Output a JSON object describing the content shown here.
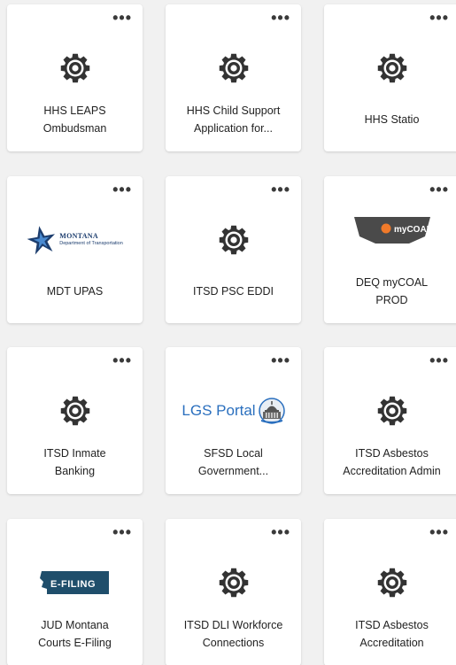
{
  "tiles": [
    {
      "label_line1": "HHS LEAPS",
      "label_line2": "Ombudsman",
      "icon": "gear-icon",
      "more": "•••"
    },
    {
      "label_line1": "HHS Child Support",
      "label_line2": "Application for...",
      "icon": "gear-icon",
      "more": "•••"
    },
    {
      "label_line1": "HHS Statio",
      "label_line2": "",
      "icon": "gear-icon",
      "more": "•••"
    },
    {
      "label_line1": "MDT UPAS",
      "label_line2": "",
      "icon": "montana-dot-logo",
      "logo_line1": "MONTANA",
      "logo_line2": "Department of Transportation",
      "more": "•••"
    },
    {
      "label_line1": "ITSD PSC EDDI",
      "label_line2": "",
      "icon": "gear-icon",
      "more": "•••"
    },
    {
      "label_line1": "DEQ myCOAL",
      "label_line2": "PROD",
      "icon": "mycoal-logo",
      "logo_text": "myCOAL",
      "more": "•••"
    },
    {
      "label_line1": "ITSD Inmate",
      "label_line2": "Banking",
      "icon": "gear-icon",
      "more": "•••"
    },
    {
      "label_line1": "SFSD Local",
      "label_line2": "Government...",
      "icon": "lgs-portal-logo",
      "logo_text": "LGS Portal",
      "more": "•••"
    },
    {
      "label_line1": "ITSD Asbestos",
      "label_line2": "Accreditation Admin",
      "icon": "gear-icon",
      "more": "•••"
    },
    {
      "label_line1": "JUD Montana",
      "label_line2": "Courts E-Filing",
      "icon": "efiling-logo",
      "logo_text": "E-FILING",
      "more": "•••"
    },
    {
      "label_line1": "ITSD DLI Workforce",
      "label_line2": "Connections",
      "icon": "gear-icon",
      "more": "•••"
    },
    {
      "label_line1": "ITSD Asbestos",
      "label_line2": "Accreditation",
      "icon": "gear-icon",
      "more": "•••"
    }
  ],
  "colors": {
    "background": "#f1f1f1",
    "tile": "#ffffff",
    "gear": "#333333",
    "mdt_blue": "#1c3d6e",
    "lgs_blue": "#2a6fbe",
    "mycoal_gray": "#4a4a4a",
    "mycoal_orange": "#f07a2a",
    "efiling_bg": "#1f4e6b"
  }
}
